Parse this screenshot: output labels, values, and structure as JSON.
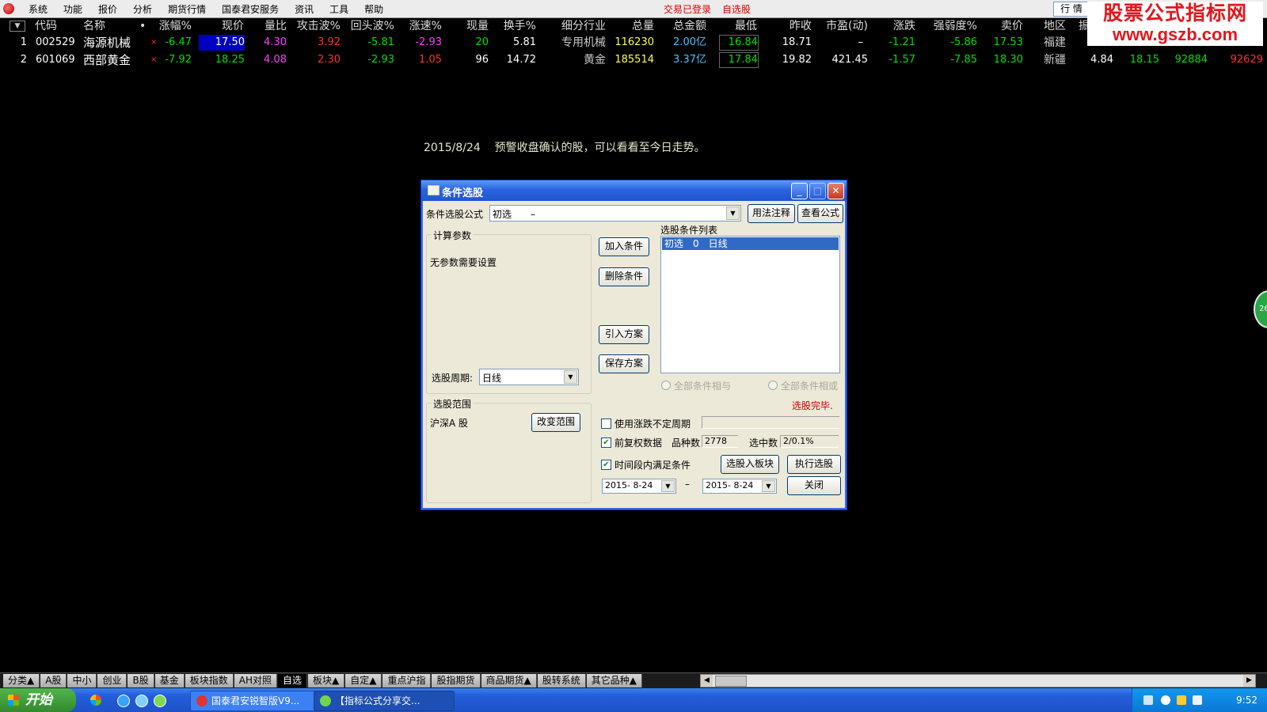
{
  "menu": {
    "items": [
      "系统",
      "功能",
      "报价",
      "分析",
      "期货行情",
      "国泰君安服务",
      "资讯",
      "工具",
      "帮助"
    ],
    "status_login": "交易已登录",
    "status_select": "自选股",
    "hq_button": "行 情"
  },
  "watermark": {
    "line1": "股票公式指标网",
    "line2": "www.gszb.com"
  },
  "table": {
    "headers": [
      "代码",
      "名称",
      "•",
      "涨幅%",
      "现价",
      "量比",
      "攻击波%",
      "回头波%",
      "涨速%",
      "现量",
      "换手%",
      "细分行业",
      "总量",
      "总金额",
      "最低",
      "昨收",
      "市盈(动)",
      "涨跌",
      "强弱度%",
      "卖价",
      "地区",
      "振"
    ],
    "rows": [
      {
        "idx": "1",
        "code": "002529",
        "name": "海源机械",
        "mark": "×",
        "chg": "-6.47",
        "price": "17.50",
        "vr": "4.30",
        "atk": "3.92",
        "back": "-5.81",
        "speed": "-2.93",
        "vol_now": "20",
        "turnover": "5.81",
        "industry": "专用机械",
        "vol": "116230",
        "amount": "2.00亿",
        "low": "16.84",
        "prev": "18.71",
        "pe": "–",
        "delta": "-1.21",
        "strength": "-5.86",
        "ask": "17.53",
        "region": "福建",
        "extra": [
          "",
          "",
          "",
          ""
        ]
      },
      {
        "idx": "2",
        "code": "601069",
        "name": "西部黄金",
        "mark": "×",
        "chg": "-7.92",
        "price": "18.25",
        "vr": "4.08",
        "atk": "2.30",
        "back": "-2.93",
        "speed": "1.05",
        "vol_now": "96",
        "turnover": "14.72",
        "industry": "黄金",
        "vol": "185514",
        "amount": "3.37亿",
        "low": "17.84",
        "prev": "19.82",
        "pe": "421.45",
        "delta": "-1.57",
        "strength": "-7.85",
        "ask": "18.30",
        "region": "新疆",
        "extra": [
          "4.84",
          "18.15",
          "92884",
          "92629"
        ]
      }
    ]
  },
  "note": {
    "date": "2015/8/24",
    "text": "预警收盘确认的股，可以看看至今日走势。"
  },
  "dialog": {
    "title": "条件选股",
    "formula_label": "条件选股公式",
    "formula_value": "初选　　–",
    "usage_btn": "用法注释",
    "view_btn": "查看公式",
    "params_group": "计算参数",
    "params_text": "无参数需要设置",
    "period_label": "选股周期:",
    "period_value": "日线",
    "scope_group": "选股范围",
    "scope_value": "沪深A 股",
    "change_scope_btn": "改变范围",
    "add_btn": "加入条件",
    "del_btn": "删除条件",
    "import_btn": "引入方案",
    "save_btn": "保存方案",
    "cond_list_label": "选股条件列表",
    "cond_items": [
      "初选　0　日线"
    ],
    "radio_and": "全部条件相与",
    "radio_or": "全部条件相或",
    "done_text": "选股完毕.",
    "use_uncertain": "使用涨跌不定周期",
    "forward_adj": "前复权数据",
    "count_label": "品种数",
    "count_value": "2778",
    "hit_label": "选中数",
    "hit_value": "2/0.1%",
    "time_cond": "时间段内满足条件",
    "to_block_btn": "选股入板块",
    "exec_btn": "执行选股",
    "date_from": "2015- 8-24",
    "date_sep": "–",
    "date_to": "2015- 8-24",
    "close_btn": "关闭"
  },
  "tabs": [
    "分类▲",
    "A股",
    "中小",
    "创业",
    "B股",
    "基金",
    "板块指数",
    "AH对照",
    "自选",
    "板块▲",
    "自定▲",
    "重点沪指",
    "股指期货",
    "商品期货▲",
    "股转系统",
    "其它品种▲"
  ],
  "active_tab": "自选",
  "taskbar": {
    "start": "开始",
    "tasks": [
      "国泰君安锐智版V9...",
      "【指标公式分享交..."
    ],
    "clock": "9:52",
    "side_badge": "26"
  }
}
